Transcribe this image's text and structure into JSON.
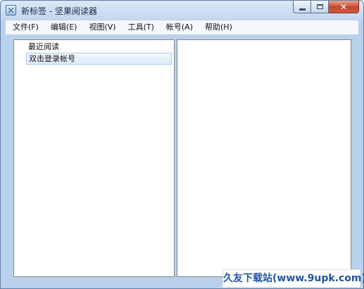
{
  "window": {
    "title": "新标签 - 坚果阅读器"
  },
  "menu": [
    {
      "label": "文件(F)"
    },
    {
      "label": "编辑(E)"
    },
    {
      "label": "视图(V)"
    },
    {
      "label": "工具(T)"
    },
    {
      "label": "帐号(A)"
    },
    {
      "label": "帮助(H)"
    }
  ],
  "tree": {
    "recent": "最近阅读",
    "login": "双击登录帐号"
  },
  "watermark": "久友下载站(www.9upk.com)",
  "colors": {
    "title_gradient_top": "#dbe8f7",
    "close_button": "#c5452c",
    "selection_border": "#a8c9ea",
    "watermark_text": "#1e56a0"
  },
  "icons": {
    "app": "app-logo-icon",
    "minimize": "minimize-icon",
    "maximize": "maximize-icon",
    "close": "close-icon"
  }
}
